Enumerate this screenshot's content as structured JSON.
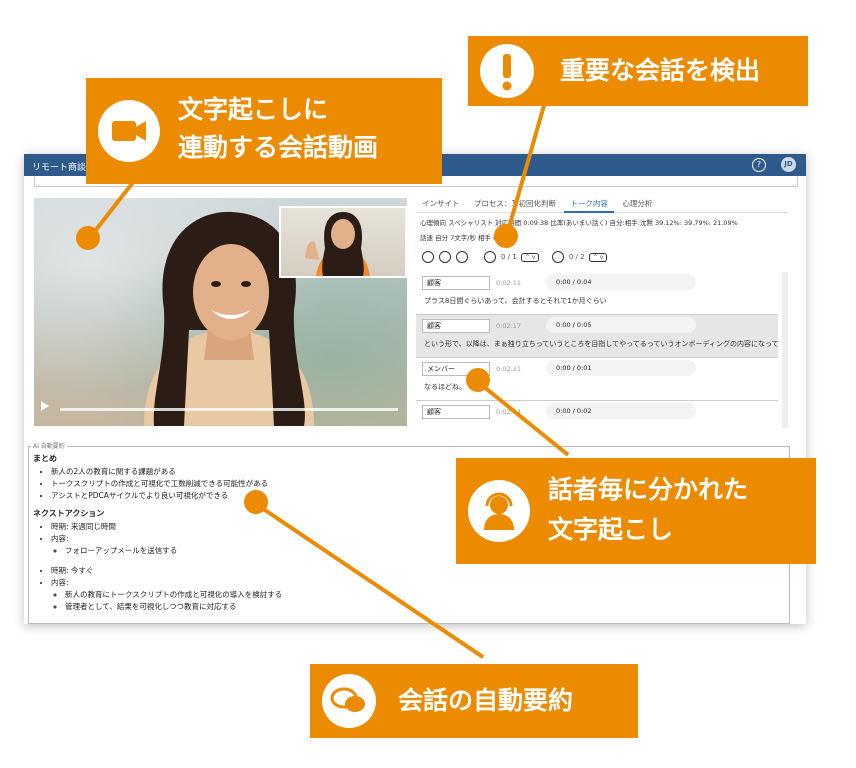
{
  "topbar": {
    "crumb": "リモート商談",
    "help": "?",
    "avatar": "JD"
  },
  "video": {
    "play_icon": "play-icon"
  },
  "tabs": [
    "インサイト",
    "プロセス：1.初回化判断",
    "トーク内容",
    "心理分析"
  ],
  "active_tab": 2,
  "meta": {
    "line1": "心理傾向 スペシャリスト 対応時間 0:09:38 比率(あいまい話く) 自分:相手:沈黙 39.12%: 39.79%: 21.09%",
    "line2": "話速 自分 7文字/秒 相手 6.5"
  },
  "controls": {
    "counter1": "0 / 1",
    "counter2": "0 / 2"
  },
  "transcript": [
    {
      "speaker": "顧客",
      "time": "0:02:11",
      "audio": "0:00 / 0:04",
      "text": "プラス8日間ぐらいあって、会計するとそれで1か月ぐらい"
    },
    {
      "speaker": "顧客",
      "time": "0:02:17",
      "audio": "0:00 / 0:05",
      "text": "という形で、以降は、まぁ独り立ちっていうところを目指してやってるっていうオンボーディングの内容になってます。"
    },
    {
      "speaker": "メンバー",
      "time": "0:02:21",
      "audio": "0:00 / 0:01",
      "text": "なるほどね。"
    },
    {
      "speaker": "顧客",
      "time": "0:02:24",
      "audio": "0:00 / 0:02",
      "text": ""
    }
  ],
  "summary": {
    "legend": "AI 自動要約",
    "matome_title": "まとめ",
    "matome": [
      "新人の2人の教育に関する課題がある",
      "トークスクリプトの作成と可視化で工数削減できる可能性がある",
      "アシストとPDCAサイクルでより良い可視化ができる"
    ],
    "next_title": "ネクストアクション",
    "next1_when": "時期: 来週同じ時間",
    "next1_content_label": "内容:",
    "next1_items": [
      "フォローアップメールを送信する"
    ],
    "next2_when": "時期: 今すぐ",
    "next2_content_label": "内容:",
    "next2_items": [
      "新人の教育にトークスクリプトの作成と可視化の導入を検討する",
      "管理者として、結果を可視化しつつ教育に対応する"
    ]
  },
  "callouts": {
    "video": [
      "文字起こしに",
      "連動する会話動画"
    ],
    "detect": "重要な会話を検出",
    "speaker": [
      "話者毎に分かれた",
      "文字起こし"
    ],
    "summary": "会話の自動要約"
  },
  "colors": {
    "accent": "#ec8a00",
    "header": "#2f5a8c"
  }
}
